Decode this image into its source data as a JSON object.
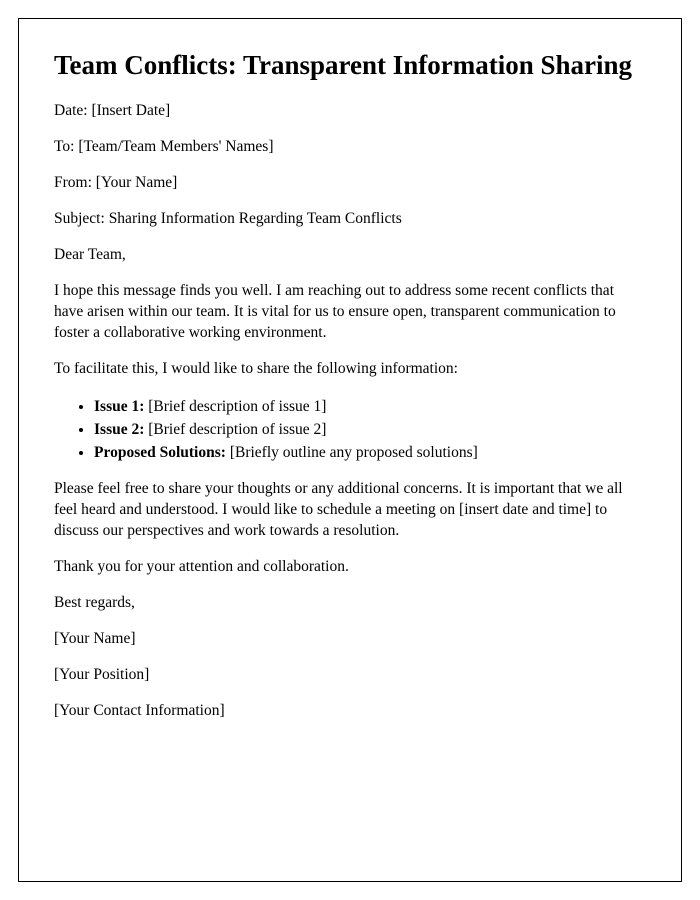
{
  "title": "Team Conflicts: Transparent Information Sharing",
  "header": {
    "date_label": "Date: ",
    "date_value": "[Insert Date]",
    "to_label": "To: ",
    "to_value": "[Team/Team Members' Names]",
    "from_label": "From: ",
    "from_value": "[Your Name]",
    "subject_label": "Subject: ",
    "subject_value": "Sharing Information Regarding Team Conflicts"
  },
  "salutation": "Dear Team,",
  "intro_paragraph": "I hope this message finds you well. I am reaching out to address some recent conflicts that have arisen within our team. It is vital for us to ensure open, transparent communication to foster a collaborative working environment.",
  "list_intro": "To facilitate this, I would like to share the following information:",
  "bullets": {
    "issue1_label": "Issue 1: ",
    "issue1_value": "[Brief description of issue 1]",
    "issue2_label": "Issue 2: ",
    "issue2_value": "[Brief description of issue 2]",
    "solutions_label": "Proposed Solutions: ",
    "solutions_value": "[Briefly outline any proposed solutions]"
  },
  "closing_paragraph": "Please feel free to share your thoughts or any additional concerns. It is important that we all feel heard and understood. I would like to schedule a meeting on [insert date and time] to discuss our perspectives and work towards a resolution.",
  "thanks": "Thank you for your attention and collaboration.",
  "signoff": {
    "regards": "Best regards,",
    "name": "[Your Name]",
    "position": "[Your Position]",
    "contact": "[Your Contact Information]"
  }
}
